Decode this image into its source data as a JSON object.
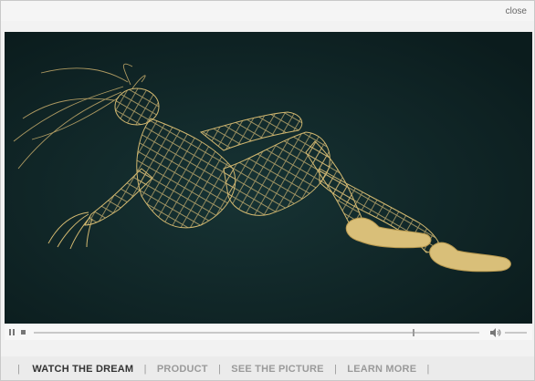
{
  "header": {
    "close_label": "close"
  },
  "player": {
    "state": "paused",
    "video_subject": "golden wire-mesh sculpture of a reclining figure on a dark teal background",
    "progress": 0.85
  },
  "nav": {
    "separator": "|",
    "items": [
      {
        "label": "WATCH THE DREAM",
        "active": true
      },
      {
        "label": "PRODUCT",
        "active": false
      },
      {
        "label": "SEE THE PICTURE",
        "active": false
      },
      {
        "label": "LEARN MORE",
        "active": false
      }
    ]
  },
  "colors": {
    "video_background": "#0f2526",
    "wire_gold": "#d9bf79",
    "nav_active": "#333333",
    "nav_inactive": "#9a9a9a"
  }
}
